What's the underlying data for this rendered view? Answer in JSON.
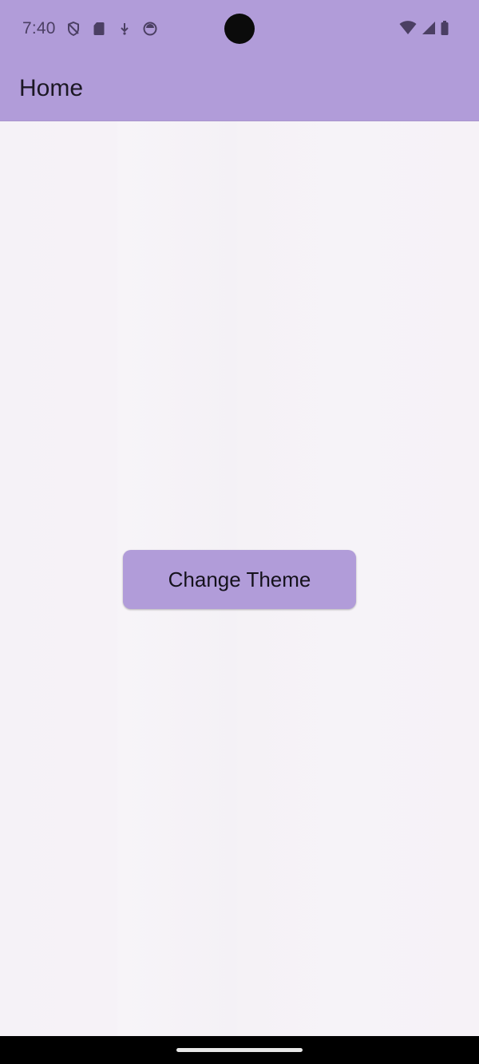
{
  "status_bar": {
    "time": "7:40",
    "left_icons": [
      "shield-icon",
      "sd-card-icon",
      "download-icon",
      "sync-icon"
    ],
    "right_icons": [
      "wifi-icon",
      "cellular-signal-icon",
      "battery-icon"
    ]
  },
  "app_bar": {
    "title": "Home"
  },
  "main": {
    "change_theme_label": "Change Theme"
  },
  "colors": {
    "primary": "#b19cd9",
    "background": "#f6f2f7",
    "navigation_bar": "#000000"
  }
}
